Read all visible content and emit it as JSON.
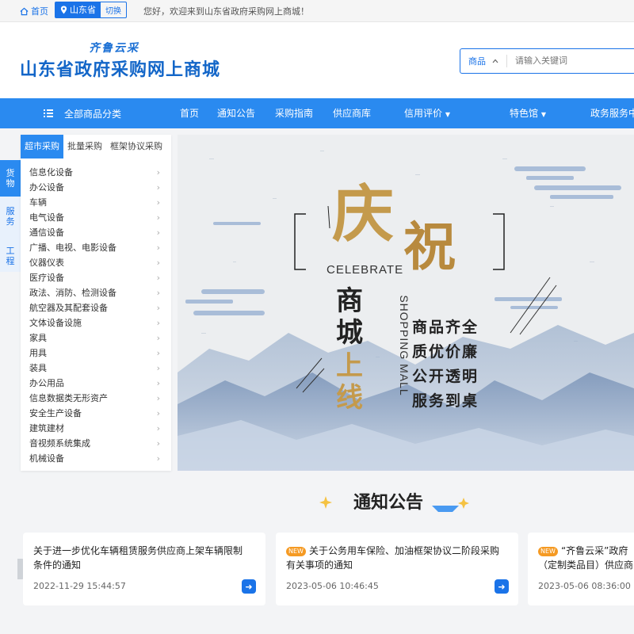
{
  "topbar": {
    "home": "首页",
    "province": "山东省",
    "switch": "切换",
    "welcome": "您好，欢迎来到山东省政府采购网上商城！"
  },
  "header": {
    "logo_small": "齐鲁云采",
    "logo_main": "山东省政府采购网上商城",
    "search_category": "商品",
    "search_placeholder": "请输入关键词"
  },
  "nav": {
    "all_categories": "全部商品分类",
    "items": [
      "首页",
      "通知公告",
      "采购指南",
      "供应商库",
      "信用评价",
      "特色馆",
      "政务服务中"
    ]
  },
  "sidebar_tabs": [
    "货物",
    "服务",
    "工程"
  ],
  "category_tabs": [
    "超市采购",
    "批量采购",
    "框架协议采购"
  ],
  "categories": [
    "信息化设备",
    "办公设备",
    "车辆",
    "电气设备",
    "通信设备",
    "广播、电视、电影设备",
    "仪器仪表",
    "医疗设备",
    "政法、消防、检测设备",
    "航空器及其配套设备",
    "文体设备设施",
    "家具",
    "用具",
    "装具",
    "办公用品",
    "信息数据类无形资产",
    "安全生产设备",
    "建筑建材",
    "音视频系统集成",
    "机械设备"
  ],
  "banner": {
    "qing": "庆",
    "zhu": "祝",
    "celebrate": "CELEBRATE",
    "shangcheng": "商城",
    "shangxian": "上线",
    "shopping_mall": "SHOPPING MALL",
    "slogans": [
      "商品齐全",
      "质优价廉",
      "公开透明",
      "服务到桌"
    ]
  },
  "notice": {
    "title": "通知公告",
    "badge": "NEW",
    "cards": [
      {
        "title": "关于进一步优化车辆租赁服务供应商上架车辆限制条件的通知",
        "date": "2022-11-29 15:44:57",
        "is_new": false
      },
      {
        "title": "关于公务用车保险、加油框架协议二阶段采购有关事项的通知",
        "date": "2023-05-06 10:46:45",
        "is_new": true
      },
      {
        "title": "“齐鲁云采”政府（定制类品目）供应商",
        "date": "2023-05-06 08:36:00",
        "is_new": true
      }
    ]
  },
  "colors": {
    "brand_blue": "#2a8af0",
    "link_blue": "#1a73e8",
    "badge_orange": "#f59a23",
    "gold": "#c9a45a"
  }
}
